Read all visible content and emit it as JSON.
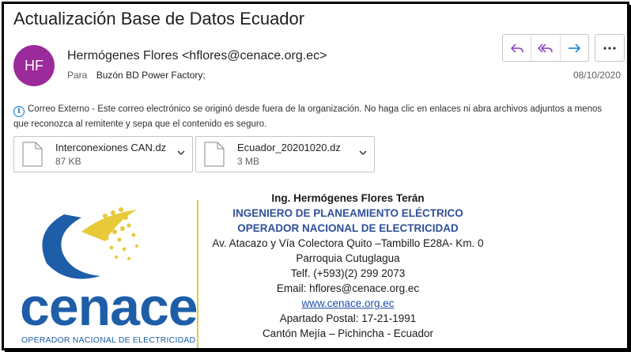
{
  "email": {
    "subject": "Actualización Base de Datos Ecuador",
    "avatar_initials": "HF",
    "avatar_color": "#9b2a9a",
    "sender": "Hermógenes Flores <hflores@cenace.org.ec>",
    "to_label": "Para",
    "to_value": "Buzón BD Power Factory;",
    "date": "08/10/2020",
    "actions": [
      {
        "name": "reply",
        "icon": "reply-icon"
      },
      {
        "name": "reply-all",
        "icon": "reply-all-icon"
      },
      {
        "name": "forward",
        "icon": "forward-icon"
      },
      {
        "name": "more",
        "icon": "more-icon"
      }
    ],
    "accent_color": "#8a3ab9",
    "external_notice": "Correo Externo - Este correo electrónico se originó desde fuera de la organización. No haga clic en enlaces ni abra archivos adjuntos a menos que reconozca al remitente y sepa que el contenido es seguro.",
    "attachments": [
      {
        "name": "Interconexiones CAN.dz",
        "size": "87 KB"
      },
      {
        "name": "Ecuador_20201020.dz",
        "size": "3 MB"
      }
    ]
  },
  "signature": {
    "logo_text": "cenace",
    "logo_subtitle": "OPERADOR NACIONAL DE ELECTRICIDAD",
    "name": "Ing. Hermógenes Flores Terán",
    "role1": "INGENIERO DE PLANEAMIENTO ELÉCTRICO",
    "role2": "OPERADOR NACIONAL DE ELECTRICIDAD",
    "address": "Av. Atacazo y Vía Colectora Quito –Tambillo E28A- Km. 0",
    "parish": "Parroquia Cutuglagua",
    "phone": "Telf. (+593)(2) 299 2073",
    "email": "Email: hflores@cenace.org.ec",
    "web": "www.cenace.org.ec",
    "po_box": "Apartado Postal: 17-21-1991",
    "canton": "Cantón Mejía –  Pichincha -  Ecuador"
  }
}
